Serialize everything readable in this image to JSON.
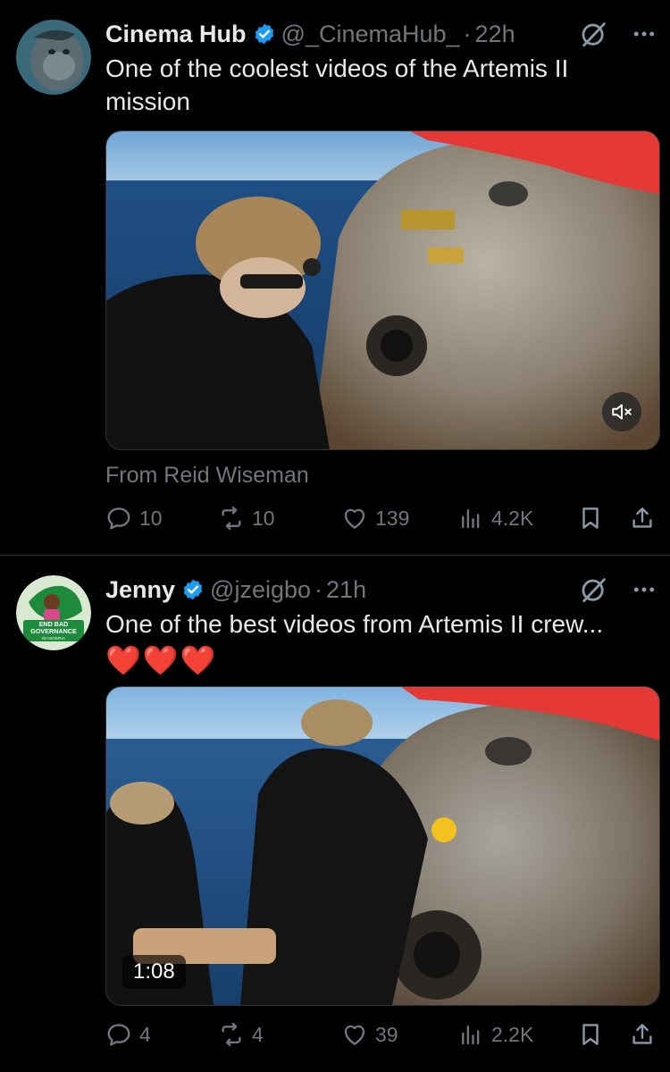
{
  "posts": [
    {
      "author_name": "Cinema Hub",
      "handle": "@_CinemaHub_",
      "separator": "·",
      "time": "22h",
      "text": "One of the coolest videos of the Artemis II mission",
      "source": "From Reid Wiseman",
      "stats": {
        "replies": "10",
        "reposts": "10",
        "likes": "139",
        "views": "4.2K"
      },
      "media_overlay": "mute-icon"
    },
    {
      "author_name": "Jenny",
      "handle": "@jzeigbo",
      "separator": "·",
      "time": "21h",
      "text": "One of the best videos from Artemis II crew...",
      "emoji": "❤️❤️❤️",
      "avatar_text": {
        "line1": "END BAD",
        "line2": "GOVERNANCE",
        "line3": "IN NIGERIA"
      },
      "duration": "1:08",
      "stats": {
        "replies": "4",
        "reposts": "4",
        "likes": "39",
        "views": "2.2K"
      }
    }
  ],
  "colors": {
    "background": "#000000",
    "text": "#e7e9ea",
    "secondary": "#71767b",
    "verified": "#1d9bf0",
    "divider": "#2f3336"
  },
  "icons": [
    "verified-badge-icon",
    "grok-icon",
    "more-icon",
    "reply-icon",
    "repost-icon",
    "like-icon",
    "views-icon",
    "bookmark-icon",
    "share-icon",
    "mute-icon"
  ]
}
